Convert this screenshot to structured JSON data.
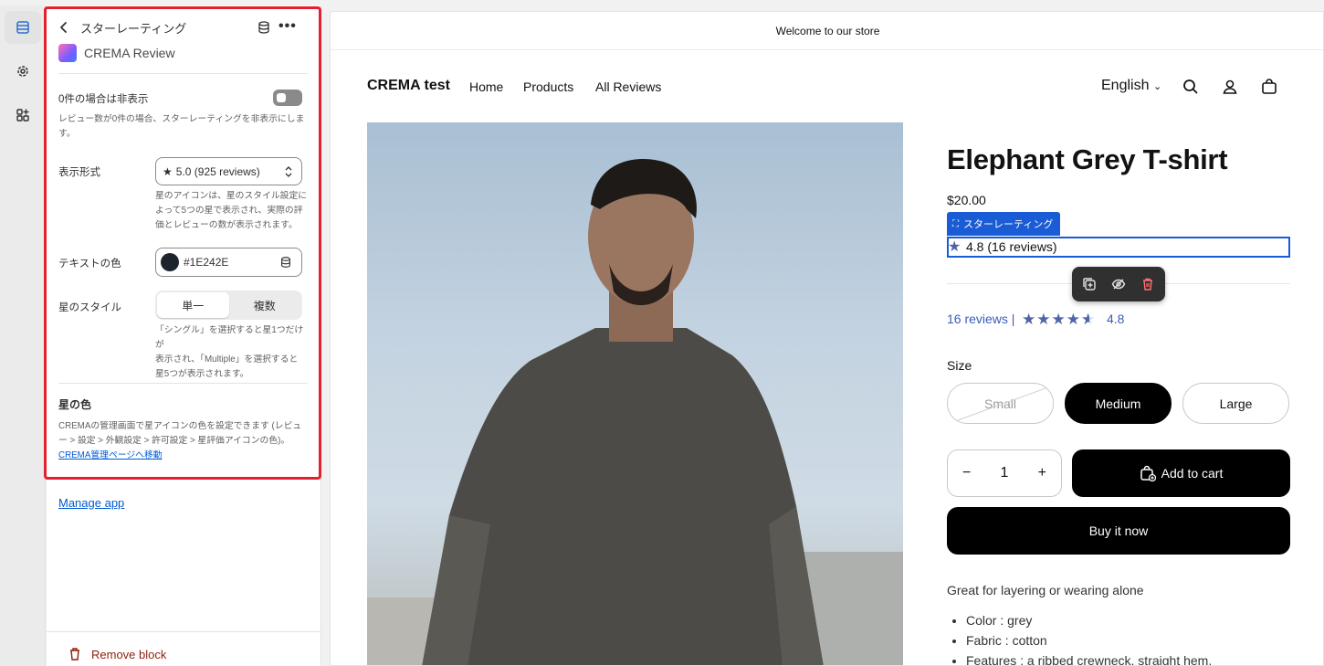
{
  "panel": {
    "title": "スターレーティング",
    "app_name": "CREMA Review",
    "hide_zero_label": "0件の場合は非表示",
    "hide_zero_help_1": "レビュー数が0件の場合、スターレーティングを非表示にしま",
    "hide_zero_help_2": "す。",
    "display_format_label": "表示形式",
    "display_format_value": "5.0 (925 reviews)",
    "display_format_help_1": "星のアイコンは、星のスタイル設定に",
    "display_format_help_2": "よって5つの星で表示され、実際の評",
    "display_format_help_3": "価とレビューの数が表示されます。",
    "text_color_label": "テキストの色",
    "text_color_value": "#1E242E",
    "star_style_label": "星のスタイル",
    "star_style_single": "単一",
    "star_style_multiple": "複数",
    "star_style_help_1": "「シングル」を選択すると星1つだけが",
    "star_style_help_2": "表示され、「Multiple」を選択すると",
    "star_style_help_3": "星5つが表示されます。",
    "star_color_title": "星の色",
    "star_color_help_1": "CREMAの管理画面で星アイコンの色を設定できます (レビュ",
    "star_color_help_2": "ー > 設定 > 外観設定 > 許可設定 > 星評価アイコンの色)。",
    "star_color_link": "CREMA管理ページへ移動",
    "manage_app": "Manage app",
    "remove_block": "Remove block"
  },
  "store": {
    "announcement": "Welcome to our store",
    "brand": "CREMA test",
    "nav": [
      "Home",
      "Products",
      "All Reviews"
    ],
    "language": "English",
    "product_title": "Elephant Grey T-shirt",
    "price": "$20.00",
    "block_tag": "スターレーティング",
    "block_rating": "4.8 (16 reviews)",
    "reviews_link": "16 reviews",
    "rating_value": "4.8",
    "rating_fraction": 0.96,
    "size_label": "Size",
    "sizes": [
      "Small",
      "Medium",
      "Large"
    ],
    "quantity": "1",
    "add_to_cart": "Add to cart",
    "buy_now": "Buy it now",
    "description": "Great for layering or wearing alone",
    "features": [
      "Color : grey",
      "Fabric : cotton",
      "Features : a ribbed crewneck, straight hem,"
    ]
  },
  "colors": {
    "accent": "#1a5bd6",
    "highlight": "#e5202e",
    "star": "#4e64a8"
  }
}
